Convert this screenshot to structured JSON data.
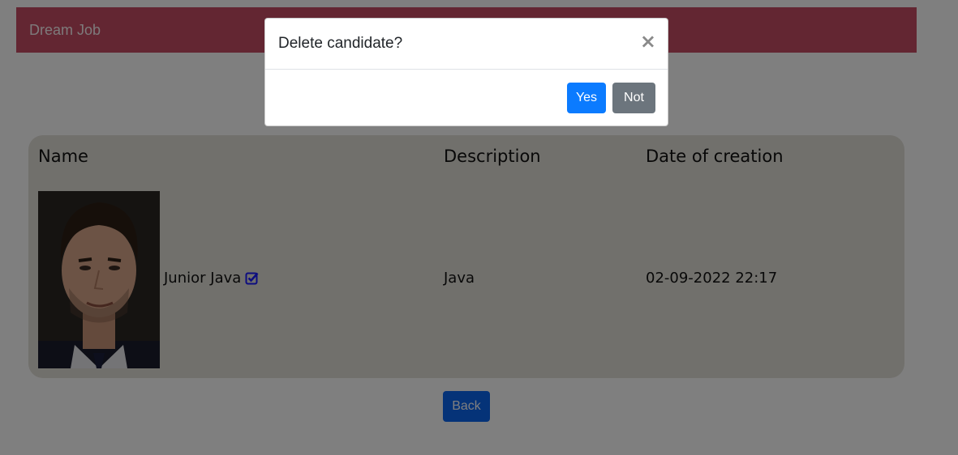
{
  "navbar": {
    "brand": "Dream Job"
  },
  "table": {
    "headers": {
      "name": "Name",
      "description": "Description",
      "date": "Date of creation"
    },
    "rows": [
      {
        "name": "Junior Java",
        "description": "Java",
        "date": "02-09-2022 22:17",
        "icon": "checkbox-checked-icon"
      }
    ]
  },
  "back_label": "Back",
  "modal": {
    "title": "Delete candidate?",
    "close": "×",
    "yes_label": "Yes",
    "no_label": "Not"
  },
  "colors": {
    "navbar": "#c74d65",
    "primary": "#0b7bff",
    "secondary": "#6c757d",
    "check": "#1a1aff"
  }
}
